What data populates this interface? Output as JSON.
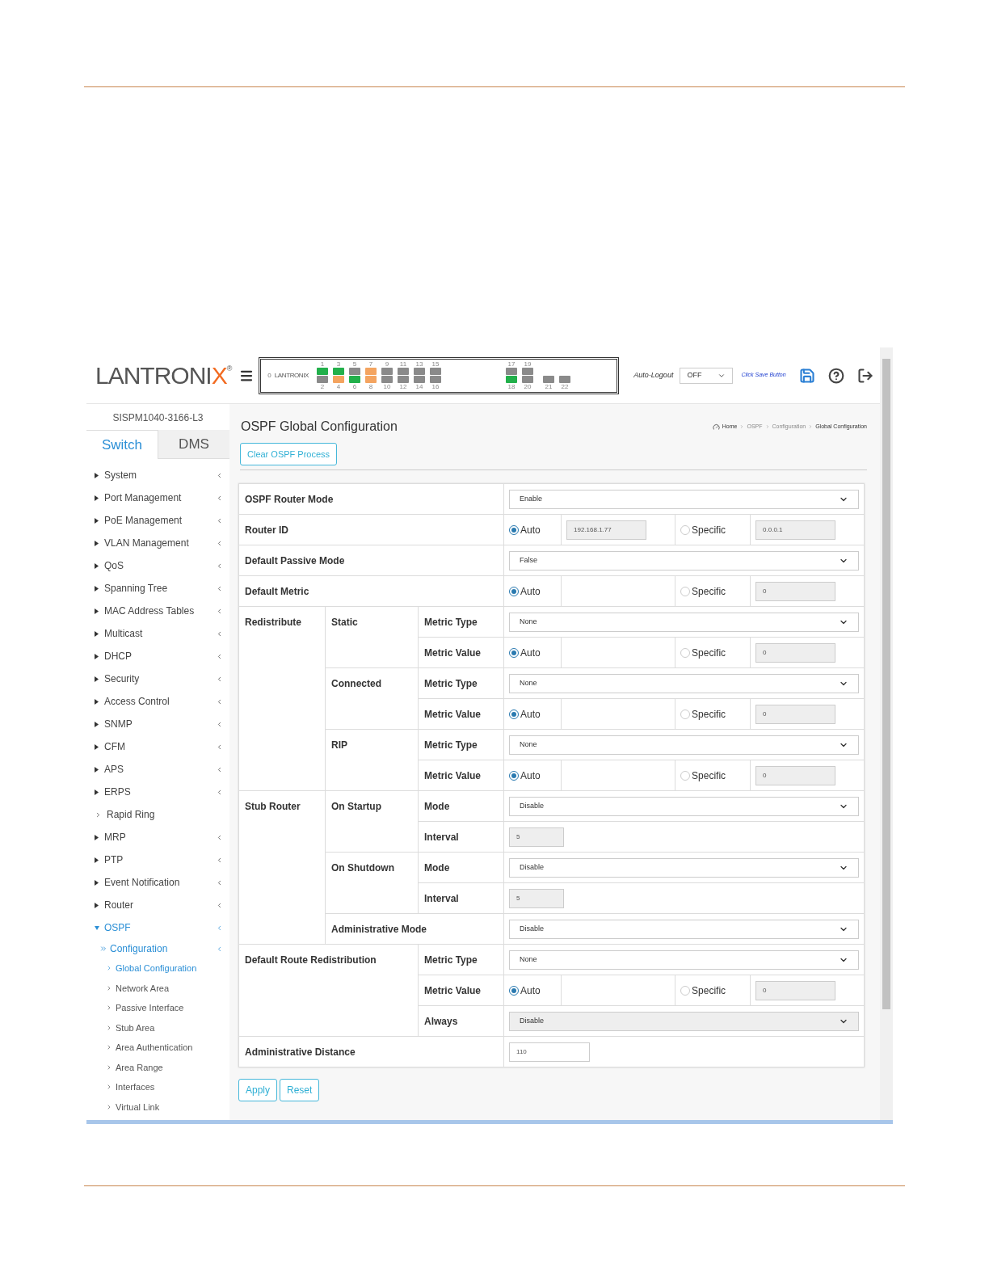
{
  "header": {
    "logo": {
      "main": "LANTRONI",
      "accent": "X",
      "mark": "®"
    },
    "port_panel": {
      "logo": "LANTRONIX",
      "uplink_label": "0",
      "groups": [
        {
          "columns": [
            {
              "top": {
                "label": "1",
                "color": "#22b04b"
              },
              "bottom": {
                "label": "2",
                "color": "#8a8a8a"
              }
            },
            {
              "top": {
                "label": "3",
                "color": "#22b04b"
              },
              "bottom": {
                "label": "4",
                "color": "#f4a460"
              }
            },
            {
              "top": {
                "label": "5",
                "color": "#8a8a8a"
              },
              "bottom": {
                "label": "6",
                "color": "#22b04b"
              }
            },
            {
              "top": {
                "label": "7",
                "color": "#f4a460"
              },
              "bottom": {
                "label": "8",
                "color": "#f4a460"
              }
            },
            {
              "top": {
                "label": "9",
                "color": "#8a8a8a"
              },
              "bottom": {
                "label": "10",
                "color": "#8a8a8a"
              }
            },
            {
              "top": {
                "label": "11",
                "color": "#8a8a8a"
              },
              "bottom": {
                "label": "12",
                "color": "#8a8a8a"
              }
            },
            {
              "top": {
                "label": "13",
                "color": "#8a8a8a"
              },
              "bottom": {
                "label": "14",
                "color": "#8a8a8a"
              }
            },
            {
              "top": {
                "label": "15",
                "color": "#8a8a8a"
              },
              "bottom": {
                "label": "16",
                "color": "#8a8a8a"
              }
            }
          ]
        },
        {
          "columns": [
            {
              "top": {
                "label": "17",
                "color": "#8a8a8a"
              },
              "bottom": {
                "label": "18",
                "color": "#22b04b"
              }
            },
            {
              "top": {
                "label": "19",
                "color": "#8a8a8a"
              },
              "bottom": {
                "label": "20",
                "color": "#8a8a8a"
              }
            }
          ]
        },
        {
          "columns": [
            {
              "bottom": {
                "label": "21",
                "color": "#8a8a8a"
              }
            },
            {
              "bottom": {
                "label": "22",
                "color": "#8a8a8a"
              }
            }
          ]
        }
      ]
    },
    "auto_logout": {
      "label": "Auto-Logout",
      "value": "OFF"
    },
    "save_link": "Click Save Button"
  },
  "sidebar": {
    "device": "SISPM1040-3166-L3",
    "tabs": [
      {
        "label": "Switch",
        "selected": true
      },
      {
        "label": "DMS",
        "selected": false
      }
    ],
    "menu": [
      {
        "kind": "submenu",
        "label": "System",
        "expanded": false
      },
      {
        "kind": "submenu",
        "label": "Port Management",
        "expanded": false
      },
      {
        "kind": "submenu",
        "label": "PoE Management",
        "expanded": false
      },
      {
        "kind": "submenu",
        "label": "VLAN Management",
        "expanded": false
      },
      {
        "kind": "submenu",
        "label": "QoS",
        "expanded": false
      },
      {
        "kind": "submenu",
        "label": "Spanning Tree",
        "expanded": false
      },
      {
        "kind": "submenu",
        "label": "MAC Address Tables",
        "expanded": false
      },
      {
        "kind": "submenu",
        "label": "Multicast",
        "expanded": false
      },
      {
        "kind": "submenu",
        "label": "DHCP",
        "expanded": false
      },
      {
        "kind": "submenu",
        "label": "Security",
        "expanded": false
      },
      {
        "kind": "submenu",
        "label": "Access Control",
        "expanded": false
      },
      {
        "kind": "submenu",
        "label": "SNMP",
        "expanded": false
      },
      {
        "kind": "submenu",
        "label": "CFM",
        "expanded": false
      },
      {
        "kind": "submenu",
        "label": "APS",
        "expanded": false
      },
      {
        "kind": "submenu",
        "label": "ERPS",
        "expanded": false
      },
      {
        "kind": "link",
        "label": "Rapid Ring",
        "selected": false
      },
      {
        "kind": "submenu",
        "label": "MRP",
        "expanded": false
      },
      {
        "kind": "submenu",
        "label": "PTP",
        "expanded": false
      },
      {
        "kind": "submenu",
        "label": "Event Notification",
        "expanded": false
      },
      {
        "kind": "submenu",
        "label": "Router",
        "expanded": false
      },
      {
        "kind": "submenu",
        "label": "OSPF",
        "expanded": true,
        "children": [
          {
            "label": "Configuration",
            "expanded": true,
            "children": [
              {
                "label": "Global Configuration",
                "selected": true
              },
              {
                "label": "Network Area",
                "selected": false
              },
              {
                "label": "Passive Interface",
                "selected": false
              },
              {
                "label": "Stub Area",
                "selected": false
              },
              {
                "label": "Area Authentication",
                "selected": false
              },
              {
                "label": "Area Range",
                "selected": false
              },
              {
                "label": "Interfaces",
                "selected": false
              },
              {
                "label": "Virtual Link",
                "selected": false
              }
            ]
          }
        ]
      }
    ]
  },
  "page": {
    "title": "OSPF Global Configuration",
    "breadcrumb": [
      "Home",
      "OSPF",
      "Configuration",
      "Global Configuration"
    ],
    "clear_button": "Clear OSPF Process",
    "settings": [
      {
        "kind": "select",
        "label": "OSPF Router Mode",
        "value": "Enable",
        "disabled": false
      },
      {
        "kind": "radio",
        "label": "Router ID",
        "options": [
          {
            "label": "Auto",
            "selected": true,
            "value": "192.168.1.77"
          },
          {
            "label": "Specific",
            "selected": false,
            "value": "0.0.0.1"
          }
        ]
      },
      {
        "kind": "select",
        "label": "Default Passive Mode",
        "value": "False",
        "disabled": false
      },
      {
        "kind": "radio",
        "label": "Default Metric",
        "options": [
          {
            "label": "Auto",
            "selected": true
          },
          {
            "label": "Specific",
            "selected": false,
            "value": "0"
          }
        ]
      },
      {
        "label": "Redistribute",
        "children": [
          {
            "label": "Static",
            "children": [
              {
                "kind": "select",
                "label": "Metric Type",
                "value": "None",
                "disabled": false
              },
              {
                "kind": "radio",
                "label": "Metric Value",
                "options": [
                  {
                    "label": "Auto",
                    "selected": true
                  },
                  {
                    "label": "Specific",
                    "selected": false,
                    "value": "0"
                  }
                ]
              }
            ]
          },
          {
            "label": "Connected",
            "children": [
              {
                "kind": "select",
                "label": "Metric Type",
                "value": "None",
                "disabled": false
              },
              {
                "kind": "radio",
                "label": "Metric Value",
                "options": [
                  {
                    "label": "Auto",
                    "selected": true
                  },
                  {
                    "label": "Specific",
                    "selected": false,
                    "value": "0"
                  }
                ]
              }
            ]
          },
          {
            "label": "RIP",
            "children": [
              {
                "kind": "select",
                "label": "Metric Type",
                "value": "None",
                "disabled": false
              },
              {
                "kind": "radio",
                "label": "Metric Value",
                "options": [
                  {
                    "label": "Auto",
                    "selected": true
                  },
                  {
                    "label": "Specific",
                    "selected": false,
                    "value": "0"
                  }
                ]
              }
            ]
          }
        ]
      },
      {
        "label": "Stub Router",
        "children": [
          {
            "label": "On Startup",
            "children": [
              {
                "kind": "select",
                "label": "Mode",
                "value": "Disable",
                "disabled": false
              },
              {
                "kind": "input",
                "label": "Interval",
                "value": "5",
                "disabled": true
              }
            ]
          },
          {
            "label": "On Shutdown",
            "children": [
              {
                "kind": "select",
                "label": "Mode",
                "value": "Disable",
                "disabled": false
              },
              {
                "kind": "input",
                "label": "Interval",
                "value": "5",
                "disabled": true
              }
            ]
          },
          {
            "kind": "select",
            "label": "Administrative Mode",
            "value": "Disable",
            "disabled": false
          }
        ]
      },
      {
        "label": "Default Route Redistribution",
        "children": [
          {
            "kind": "select",
            "label": "Metric Type",
            "value": "None",
            "disabled": false
          },
          {
            "kind": "radio",
            "label": "Metric Value",
            "options": [
              {
                "label": "Auto",
                "selected": true
              },
              {
                "label": "Specific",
                "selected": false,
                "value": "0"
              }
            ]
          },
          {
            "kind": "select",
            "label": "Always",
            "value": "Disable",
            "disabled": true
          }
        ]
      },
      {
        "kind": "input",
        "label": "Administrative Distance",
        "value": "110",
        "disabled": false
      }
    ],
    "buttons": [
      "Apply",
      "Reset"
    ]
  }
}
